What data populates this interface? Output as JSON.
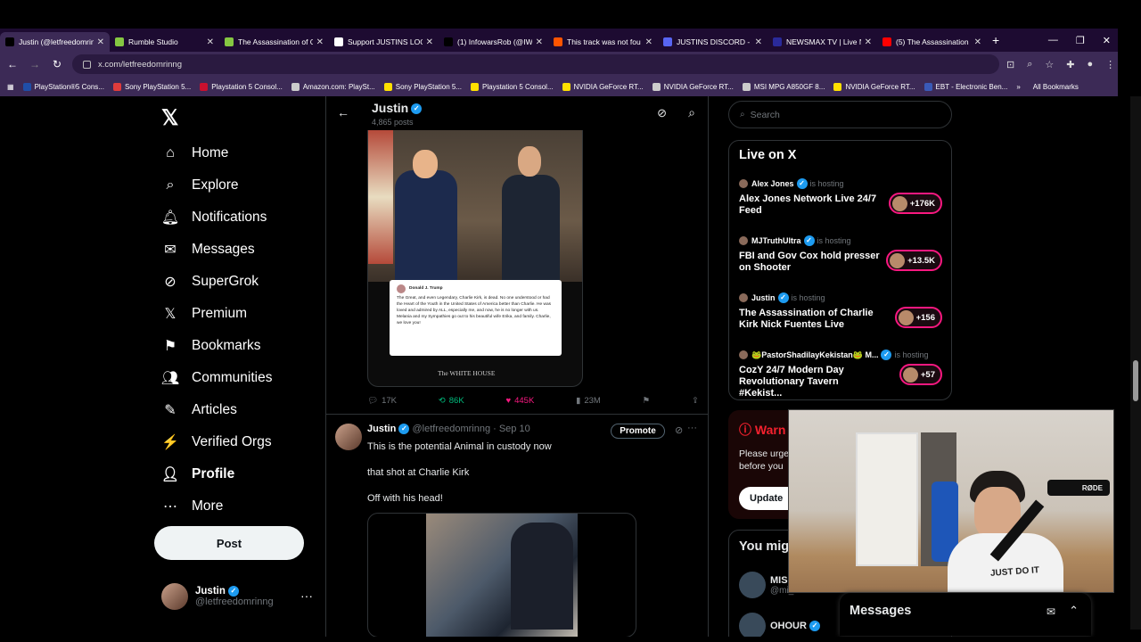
{
  "browser": {
    "tabs": [
      {
        "title": "Justin (@letfreedomrinng",
        "color": "#000000",
        "active": true
      },
      {
        "title": "Rumble Studio",
        "color": "#85c742"
      },
      {
        "title": "The Assassination of C",
        "color": "#85c742"
      },
      {
        "title": "Support JUSTINS LOC",
        "color": "#ffffff"
      },
      {
        "title": "(1) InfowarsRob (@IW",
        "color": "#000000"
      },
      {
        "title": "This track was not fou",
        "color": "#ff5500"
      },
      {
        "title": "JUSTINS DISCORD - D",
        "color": "#5865f2"
      },
      {
        "title": "NEWSMAX TV | Live N",
        "color": "#2a2a9a"
      },
      {
        "title": "(5) The Assassination",
        "color": "#ff0000"
      }
    ],
    "url": "x.com/letfreedomrinng",
    "bookmarks": [
      {
        "label": "PlayStation®5 Cons...",
        "color": "#1f4ea8"
      },
      {
        "label": "Sony PlayStation 5...",
        "color": "#e03c3c"
      },
      {
        "label": "Playstation 5 Consol...",
        "color": "#c8102e"
      },
      {
        "label": "Amazon.com: PlaySt...",
        "color": "#cccccc"
      },
      {
        "label": "Sony PlayStation 5...",
        "color": "#ffe000"
      },
      {
        "label": "Playstation 5 Consol...",
        "color": "#ffe000"
      },
      {
        "label": "NVIDIA GeForce RT...",
        "color": "#ffe000"
      },
      {
        "label": "NVIDIA GeForce RT...",
        "color": "#cccccc"
      },
      {
        "label": "MSI MPG A850GF 8...",
        "color": "#cccccc"
      },
      {
        "label": "NVIDIA GeForce RT...",
        "color": "#ffe000"
      },
      {
        "label": "EBT - Electronic Ben...",
        "color": "#3a5ab8"
      }
    ],
    "all_bookmarks": "All Bookmarks"
  },
  "nav": {
    "items": [
      "Home",
      "Explore",
      "Notifications",
      "Messages",
      "SuperGrok",
      "Premium",
      "Bookmarks",
      "Communities",
      "Articles",
      "Verified Orgs",
      "Profile",
      "More"
    ],
    "post_label": "Post",
    "account_name": "Justin",
    "account_handle": "@letfreedomrinng"
  },
  "profile_header": {
    "name": "Justin",
    "posts": "4,865 posts"
  },
  "tweet1": {
    "card_author": "Donald J. Trump",
    "card_text": "The Great, and even Legendary, Charlie Kirk, is dead. No one understood or had the Heart of the Youth in the United States of America better than Charlie. He was loved and admired by ALL, especially me, and now, he is no longer with us. Melania and my Sympathies go out to his beautiful wife Erika, and family. Charlie, we love you!",
    "watermark": "The WHITE HOUSE",
    "replies": "17K",
    "reposts": "86K",
    "likes": "445K",
    "views": "23M"
  },
  "tweet2": {
    "name": "Justin",
    "handle": "@letfreedomrinng · Sep 10",
    "promote": "Promote",
    "line1": "This is the potential Animal in custody now",
    "line2": "that shot at Charlie Kirk",
    "line3": "Off with his head!"
  },
  "right": {
    "search_placeholder": "Search",
    "live_title": "Live on X",
    "live": [
      {
        "host": "Alex Jones",
        "status": "is hosting",
        "title": "Alex Jones Network Live 24/7 Feed",
        "count": "+176K"
      },
      {
        "host": "MJTruthUltra",
        "status": "is hosting",
        "title": "FBI and Gov Cox hold presser on Shooter",
        "count": "+13.5K"
      },
      {
        "host": "Justin",
        "status": "is hosting",
        "title": "The Assassination of Charlie Kirk Nick Fuentes Live",
        "count": "+156"
      },
      {
        "host": "🐸PastorShadilayKekistan🐸 M...",
        "status": "is hosting",
        "title": "CozY 24/7 Modern Day Revolutionary Tavern #Kekist...",
        "count": "+57"
      }
    ],
    "warning_title": "Warn",
    "warning_body_1": "Please urge",
    "warning_body_2": "before you",
    "update_label": "Update",
    "ymk_title": "You mig",
    "ymk_users": [
      {
        "name": "MIS",
        "handle": "@mi_freedomstic"
      },
      {
        "name": "OHOUR",
        "handle": ""
      }
    ],
    "messages_label": "Messages"
  },
  "webcam": {
    "mic_brand": "RØDE",
    "shirt_text": "JUST DO IT"
  }
}
